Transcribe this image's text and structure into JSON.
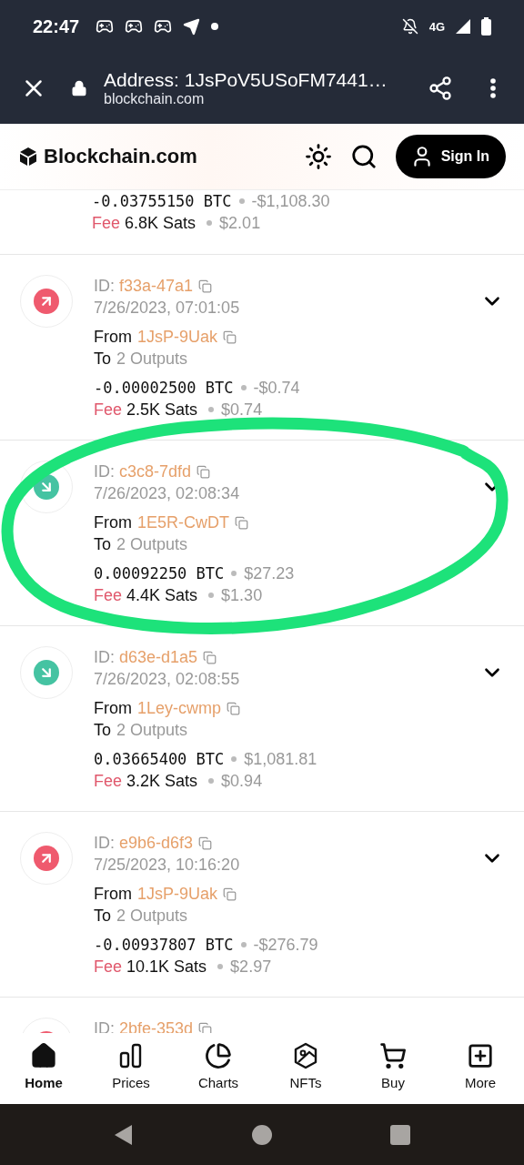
{
  "status_bar": {
    "time": "22:47",
    "network": "4G"
  },
  "browser_bar": {
    "title": "Address: 1JsPoV5USoFM7441…",
    "url": "blockchain.com"
  },
  "site_header": {
    "brand": "Blockchain.com",
    "sign_in": "Sign In"
  },
  "transactions": [
    {
      "kind": "sent",
      "amount": "-0.03755150 BTC",
      "usd": "-$1,108.30",
      "fee_label": "Fee",
      "fee": "6.8K Sats",
      "fee_usd": "$2.01"
    },
    {
      "kind": "sent",
      "id_label": "ID:",
      "id": "f33a-47a1",
      "date": "7/26/2023, 07:01:05",
      "from_label": "From",
      "from": "1JsP-9Uak",
      "to_label": "To",
      "to": "2 Outputs",
      "amount": "-0.00002500 BTC",
      "usd": "-$0.74",
      "fee_label": "Fee",
      "fee": "2.5K Sats",
      "fee_usd": "$0.74"
    },
    {
      "kind": "received",
      "id_label": "ID:",
      "id": "c3c8-7dfd",
      "date": "7/26/2023, 02:08:34",
      "from_label": "From",
      "from": "1E5R-CwDT",
      "to_label": "To",
      "to": "2 Outputs",
      "amount": "0.00092250 BTC",
      "usd": "$27.23",
      "fee_label": "Fee",
      "fee": "4.4K Sats",
      "fee_usd": "$1.30"
    },
    {
      "kind": "received",
      "id_label": "ID:",
      "id": "d63e-d1a5",
      "date": "7/26/2023, 02:08:55",
      "from_label": "From",
      "from": "1Ley-cwmp",
      "to_label": "To",
      "to": "2 Outputs",
      "amount": "0.03665400 BTC",
      "usd": "$1,081.81",
      "fee_label": "Fee",
      "fee": "3.2K Sats",
      "fee_usd": "$0.94"
    },
    {
      "kind": "sent",
      "id_label": "ID:",
      "id": "e9b6-d6f3",
      "date": "7/25/2023, 10:16:20",
      "from_label": "From",
      "from": "1JsP-9Uak",
      "to_label": "To",
      "to": "2 Outputs",
      "amount": "-0.00937807 BTC",
      "usd": "-$276.79",
      "fee_label": "Fee",
      "fee": "10.1K Sats",
      "fee_usd": "$2.97"
    },
    {
      "kind": "sent",
      "id_label": "ID:",
      "id": "2bfe-353d"
    }
  ],
  "bottom_nav": [
    {
      "kind": "home",
      "label": "Home",
      "selected": true
    },
    {
      "kind": "prices",
      "label": "Prices",
      "selected": false
    },
    {
      "kind": "charts",
      "label": "Charts",
      "selected": false
    },
    {
      "kind": "nfts",
      "label": "NFTs",
      "selected": false
    },
    {
      "kind": "buy",
      "label": "Buy",
      "selected": false
    },
    {
      "kind": "more",
      "label": "More",
      "selected": false
    }
  ]
}
